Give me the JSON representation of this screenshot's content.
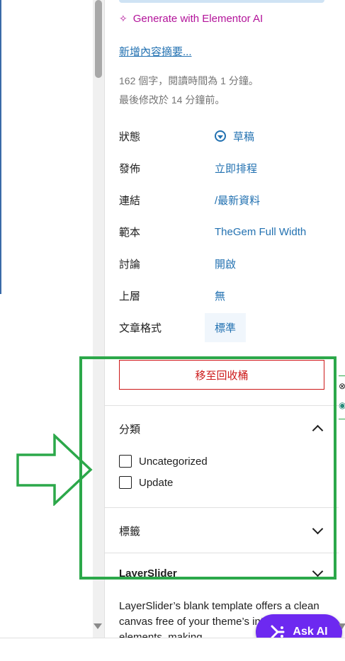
{
  "excerpt": {
    "ai_label": "Generate with Elementor AI",
    "add_excerpt_link": "新增內容摘要...",
    "stats_line1": "162 個字，閱讀時間為 1 分鐘。",
    "stats_line2": "最後修改於 14 分鐘前。"
  },
  "post_settings": {
    "rows": [
      {
        "label": "狀態",
        "value": "草稿"
      },
      {
        "label": "發佈",
        "value": "立即排程"
      },
      {
        "label": "連結",
        "value": "/最新資料"
      },
      {
        "label": "範本",
        "value": "TheGem Full Width"
      },
      {
        "label": "討論",
        "value": "開啟"
      },
      {
        "label": "上層",
        "value": "無"
      },
      {
        "label": "文章格式",
        "value": "標準"
      }
    ],
    "trash_button": "移至回收桶"
  },
  "categories": {
    "title": "分類",
    "items": [
      {
        "label": "Uncategorized",
        "checked": false
      },
      {
        "label": "Update",
        "checked": false
      }
    ]
  },
  "tags": {
    "title": "標籤"
  },
  "layerslider": {
    "title": "LayerSlider",
    "description": "LayerSlider’s blank template offers a clean canvas free of your theme’s interface elements, making"
  },
  "ask_ai": {
    "label": "Ask AI"
  },
  "colors": {
    "accent": "#2271b1",
    "ai_magenta": "#b3139a",
    "danger": "#cc1818",
    "highlight_green": "#2ca84a",
    "ask_ai_purple": "#6d29f0"
  }
}
